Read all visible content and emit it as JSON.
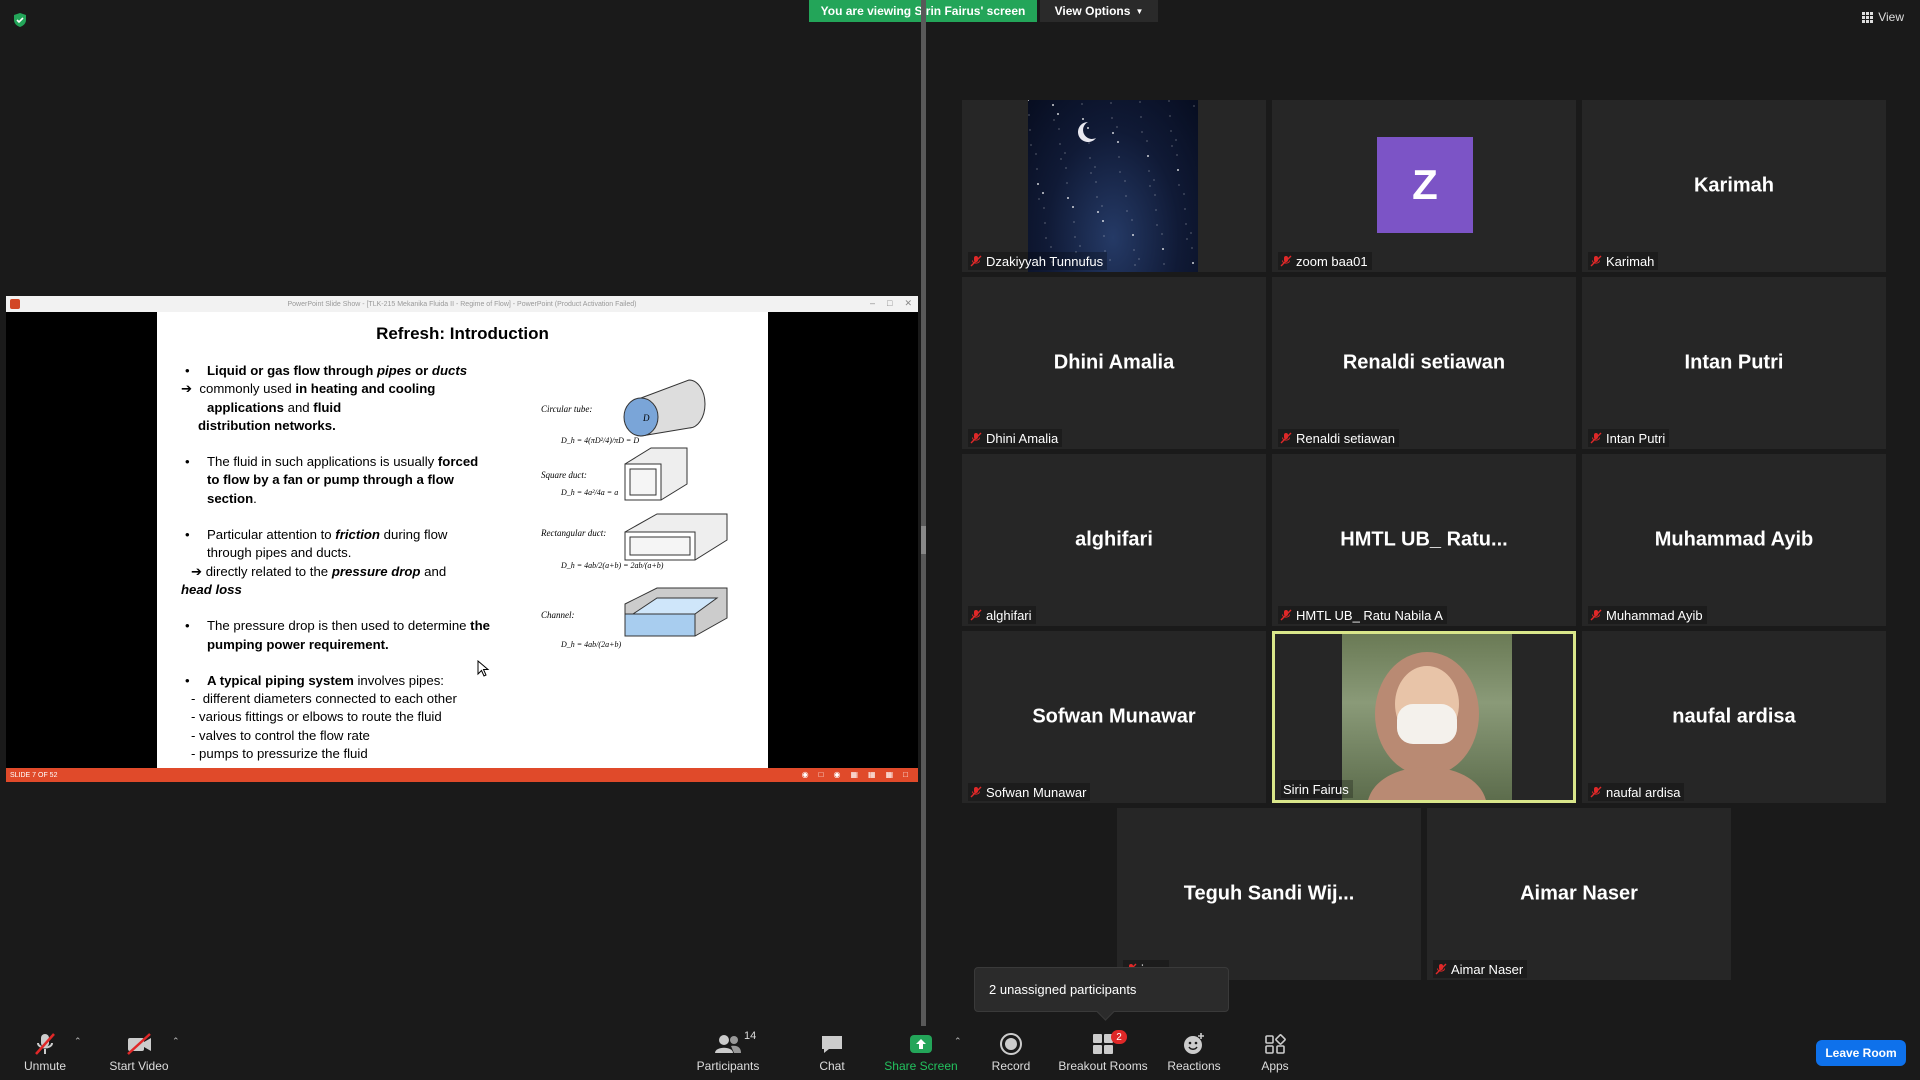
{
  "top": {
    "viewing_banner": "You are viewing Sirin Fairus' screen",
    "view_options": "View Options",
    "view_button": "View"
  },
  "share": {
    "window_title": "PowerPoint Slide Show - [TLK-215 Mekanika Fluida II - Regime of Flow] - PowerPoint (Product Activation Failed)",
    "status_text": "SLIDE 7 OF 52",
    "slide": {
      "title": "Refresh: Introduction",
      "fig_labels": {
        "circular": "Circular tube:",
        "circular_eq": "D_h = 4(πD²/4)/πD = D",
        "square": "Square duct:",
        "square_eq": "D_h = 4a²/4a = a",
        "rect": "Rectangular duct:",
        "rect_eq": "D_h = 4ab/2(a+b) = 2ab/(a+b)",
        "channel": "Channel:",
        "channel_eq": "D_h = 4ab/(2a+b)"
      }
    }
  },
  "gallery": {
    "tiles": [
      {
        "label": "Dzakiyyah Tunnufus",
        "center": ""
      },
      {
        "label": "zoom baa01",
        "center": "Z"
      },
      {
        "label": "Karimah",
        "center": "Karimah"
      },
      {
        "label": "Dhini Amalia",
        "center": "Dhini Amalia"
      },
      {
        "label": "Renaldi setiawan",
        "center": "Renaldi setiawan"
      },
      {
        "label": "Intan Putri",
        "center": "Intan Putri"
      },
      {
        "label": "alghifari",
        "center": "alghifari"
      },
      {
        "label": "HMTL UB_ Ratu Nabila A",
        "center": "HMTL UB_ Ratu..."
      },
      {
        "label": "Muhammad Ayib",
        "center": "Muhammad Ayib"
      },
      {
        "label": "Sofwan Munawar",
        "center": "Sofwan Munawar"
      },
      {
        "label": "Sirin Fairus",
        "center": ""
      },
      {
        "label": "naufal ardisa",
        "center": "naufal ardisa"
      },
      {
        "label": "jaya",
        "center": "Teguh Sandi Wij..."
      },
      {
        "label": "Aimar Naser",
        "center": "Aimar Naser"
      }
    ],
    "tooltip": "2 unassigned participants"
  },
  "toolbar": {
    "unmute": "Unmute",
    "start_video": "Start Video",
    "participants": "Participants",
    "participants_count": "14",
    "chat": "Chat",
    "share_screen": "Share Screen",
    "record": "Record",
    "breakout_rooms": "Breakout Rooms",
    "breakout_badge": "2",
    "reactions": "Reactions",
    "apps": "Apps",
    "leave_room": "Leave Room"
  },
  "colors": {
    "banner_green": "#23a559",
    "active_speaker": "#d9e68a",
    "leave_blue": "#0e71eb",
    "avatar_purple": "#7c54c6",
    "ppt_red": "#e04a2a"
  }
}
